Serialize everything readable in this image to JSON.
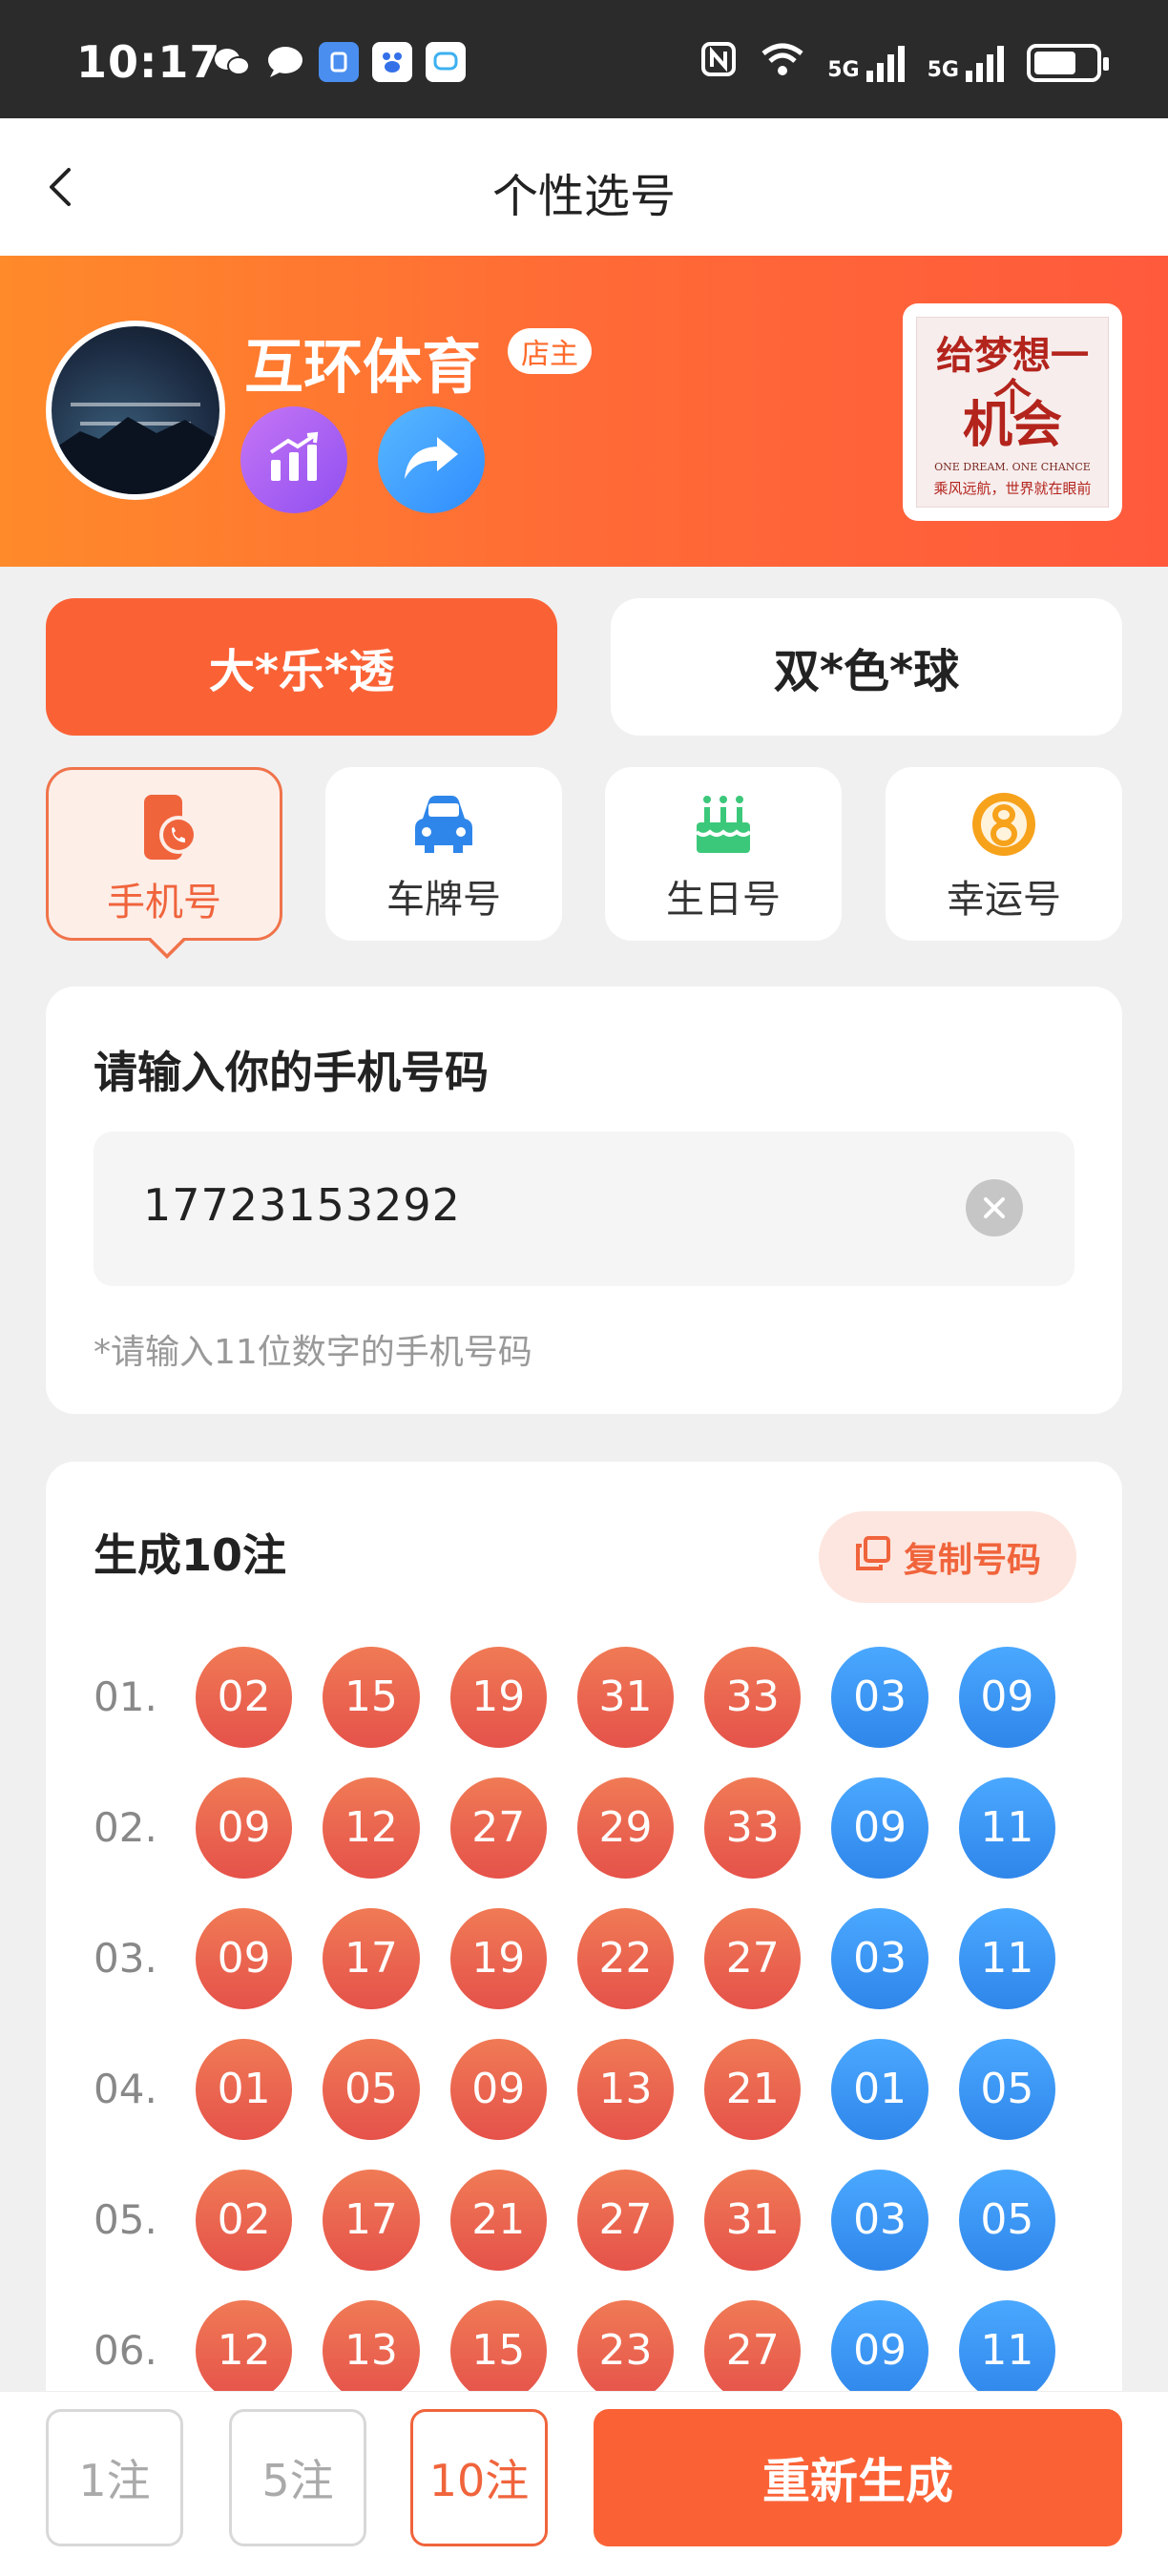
{
  "status_bar": {
    "time": "10:17",
    "network_1": "5G",
    "network_2": "5G",
    "battery_level": 0.7
  },
  "nav": {
    "title": "个性选号"
  },
  "store": {
    "name": "互环体育",
    "owner_badge": "店主",
    "logo_line1": "给梦想一个",
    "logo_line2": "机会",
    "logo_line3": "ONE DREAM. ONE CHANCE",
    "logo_line4": "乘风远航，世界就在眼前"
  },
  "lottery_tabs": [
    {
      "label": "大*乐*透",
      "active": true
    },
    {
      "label": "双*色*球",
      "active": false
    }
  ],
  "modes": [
    {
      "label": "手机号",
      "icon": "phone-icon",
      "active": true
    },
    {
      "label": "车牌号",
      "icon": "car-icon",
      "active": false
    },
    {
      "label": "生日号",
      "icon": "cake-icon",
      "active": false
    },
    {
      "label": "幸运号",
      "icon": "lucky-8-icon",
      "active": false
    }
  ],
  "phone_input": {
    "title": "请输入你的手机号码",
    "value": "17723153292",
    "hint": "*请输入11位数字的手机号码"
  },
  "results": {
    "title": "生成10注",
    "copy_label": "复制号码",
    "rows": [
      {
        "index": "01.",
        "red": [
          "02",
          "15",
          "19",
          "31",
          "33"
        ],
        "blue": [
          "03",
          "09"
        ]
      },
      {
        "index": "02.",
        "red": [
          "09",
          "12",
          "27",
          "29",
          "33"
        ],
        "blue": [
          "09",
          "11"
        ]
      },
      {
        "index": "03.",
        "red": [
          "09",
          "17",
          "19",
          "22",
          "27"
        ],
        "blue": [
          "03",
          "11"
        ]
      },
      {
        "index": "04.",
        "red": [
          "01",
          "05",
          "09",
          "13",
          "21"
        ],
        "blue": [
          "01",
          "05"
        ]
      },
      {
        "index": "05.",
        "red": [
          "02",
          "17",
          "21",
          "27",
          "31"
        ],
        "blue": [
          "03",
          "05"
        ]
      },
      {
        "index": "06.",
        "red": [
          "12",
          "13",
          "15",
          "23",
          "27"
        ],
        "blue": [
          "09",
          "11"
        ]
      }
    ]
  },
  "bottom_bar": {
    "counts": [
      {
        "label": "1注",
        "active": false
      },
      {
        "label": "5注",
        "active": false
      },
      {
        "label": "10注",
        "active": true
      }
    ],
    "regenerate_label": "重新生成"
  },
  "colors": {
    "accent": "#fa6236",
    "red_ball": "#e9604c",
    "blue_ball": "#3b97f5"
  }
}
